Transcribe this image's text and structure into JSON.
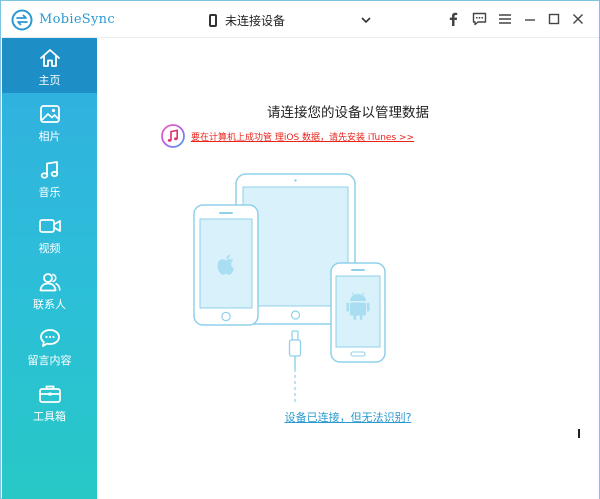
{
  "app": {
    "name": "MobieSync"
  },
  "device_select": {
    "label": "未连接设备"
  },
  "window_controls": [
    "facebook-icon",
    "feedback-icon",
    "menu-icon",
    "minimize-icon",
    "maximize-icon",
    "close-icon"
  ],
  "sidebar": {
    "items": [
      {
        "key": "home",
        "label": "主页",
        "icon": "home-icon",
        "active": true
      },
      {
        "key": "photos",
        "label": "相片",
        "icon": "photo-icon",
        "active": false
      },
      {
        "key": "music",
        "label": "音乐",
        "icon": "music-icon",
        "active": false
      },
      {
        "key": "video",
        "label": "视频",
        "icon": "video-icon",
        "active": false
      },
      {
        "key": "contacts",
        "label": "联系人",
        "icon": "contacts-icon",
        "active": false
      },
      {
        "key": "messages",
        "label": "留言内容",
        "icon": "message-icon",
        "active": false
      },
      {
        "key": "toolbox",
        "label": "工具箱",
        "icon": "toolbox-icon",
        "active": false
      }
    ]
  },
  "main": {
    "headline": "请连接您的设备以管理数据",
    "itunes_notice": "要在计算机上成功管 理iOS 数据，请先安装 iTunes >>",
    "help_link": "设备已连接，但无法识别?"
  },
  "colors": {
    "sidebar_top": "#32aee0",
    "sidebar_bottom": "#27c8c6",
    "sidebar_active": "#1d8fc6",
    "accent": "#2a9ad0",
    "warning": "#e8241b",
    "device_outline": "#8fd0ea",
    "device_screen": "#d9f1fa"
  }
}
